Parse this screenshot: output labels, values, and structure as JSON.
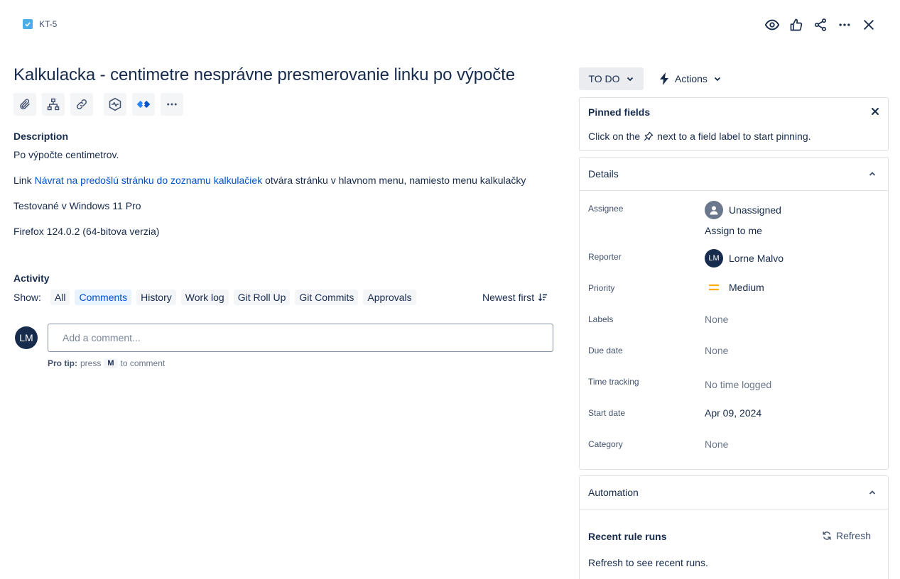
{
  "issue": {
    "key": "KT-5",
    "title": "Kalkulacka - centimetre nesprávne presmerovanie linku po výpočte"
  },
  "description": {
    "heading": "Description",
    "p1": "Po výpočte centimetrov.",
    "p2_prefix": "Link ",
    "p2_link": "Návrat na predošlú stránku do zoznamu kalkulačiek",
    "p2_suffix": " otvára stránku v hlavnom menu, namiesto menu kalkulačky",
    "p3": "Testované v Windows 11 Pro",
    "p4": "Firefox 124.0.2 (64-bitova verzia)"
  },
  "activity": {
    "heading": "Activity",
    "show_label": "Show:",
    "filters": [
      "All",
      "Comments",
      "History",
      "Work log",
      "Git Roll Up",
      "Git Commits",
      "Approvals"
    ],
    "active_filter": "Comments",
    "sort": "Newest first",
    "comment_placeholder": "Add a comment...",
    "protip_bold": "Pro tip:",
    "protip_press": "press",
    "protip_key": "M",
    "protip_suffix": "to comment"
  },
  "current_user": {
    "initials": "LM"
  },
  "status": {
    "label": "TO DO"
  },
  "actions": {
    "label": "Actions"
  },
  "pinned": {
    "title": "Pinned fields",
    "msg_prefix": "Click on the",
    "msg_suffix": "next to a field label to start pinning."
  },
  "details": {
    "title": "Details",
    "assignee_label": "Assignee",
    "assignee_value": "Unassigned",
    "assign_to_me": "Assign to me",
    "reporter_label": "Reporter",
    "reporter_initials": "LM",
    "reporter_value": "Lorne Malvo",
    "priority_label": "Priority",
    "priority_value": "Medium",
    "labels_label": "Labels",
    "labels_value": "None",
    "due_label": "Due date",
    "due_value": "None",
    "time_label": "Time tracking",
    "time_value": "No time logged",
    "start_label": "Start date",
    "start_value": "Apr 09, 2024",
    "category_label": "Category",
    "category_value": "None"
  },
  "automation": {
    "title": "Automation",
    "recent": "Recent rule runs",
    "refresh": "Refresh",
    "hint": "Refresh to see recent runs."
  },
  "colors": {
    "link": "#0052cc",
    "text": "#172b4d",
    "checkbox": "#4bade8",
    "priority": "#ffab00"
  }
}
